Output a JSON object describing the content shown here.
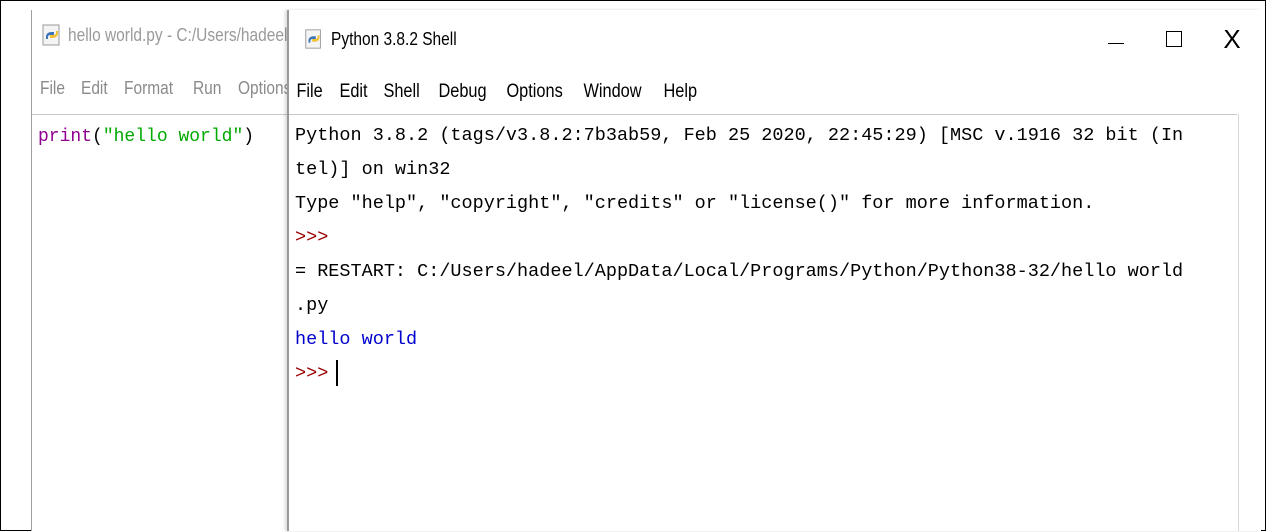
{
  "editor": {
    "title": "hello world.py - C:/Users/hadeel",
    "menu": [
      "File",
      "Edit",
      "Format",
      "Run",
      "Options"
    ],
    "code": {
      "builtin": "print",
      "open": "(",
      "string": "\"hello world\"",
      "close": ")"
    }
  },
  "shell": {
    "title": "Python 3.8.2 Shell",
    "window_controls": {
      "minimize_icon": "minimize-icon",
      "maximize_icon": "maximize-icon",
      "close_icon": "close-icon"
    },
    "menu": [
      "File",
      "Edit",
      "Shell",
      "Debug",
      "Options",
      "Window",
      "Help"
    ],
    "lines": {
      "line1": "Python 3.8.2 (tags/v3.8.2:7b3ab59, Feb 25 2020, 22:45:29) [MSC v.1916 32 bit (In",
      "line2": "tel)] on win32",
      "line3": "Type \"help\", \"copyright\", \"credits\" or \"license()\" for more information.",
      "prompt1": ">>>",
      "line5": "= RESTART: C:/Users/hadeel/AppData/Local/Programs/Python/Python38-32/hello world",
      "line6": ".py",
      "output": "hello world",
      "prompt2": ">>>"
    }
  },
  "colors": {
    "prompt": "#990000",
    "output": "#0000cc",
    "builtin": "#900090",
    "string": "#00aa00"
  }
}
